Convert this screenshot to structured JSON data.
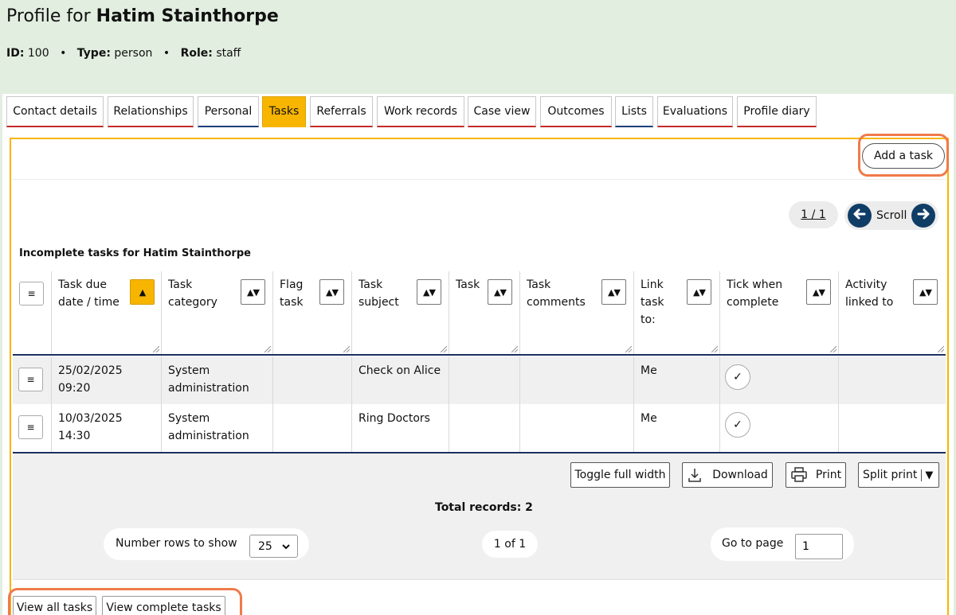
{
  "header": {
    "title_prefix": "Profile for",
    "person_name": "Hatim Stainthorpe",
    "id_label": "ID:",
    "id_value": "100",
    "type_label": "Type:",
    "type_value": "person",
    "role_label": "Role:",
    "role_value": "staff",
    "separator": "•"
  },
  "tabs": [
    {
      "label": "Contact details"
    },
    {
      "label": "Relationships"
    },
    {
      "label": "Personal"
    },
    {
      "label": "Tasks",
      "active": true
    },
    {
      "label": "Referrals"
    },
    {
      "label": "Work records"
    },
    {
      "label": "Case view"
    },
    {
      "label": "Outcomes"
    },
    {
      "label": "Lists"
    },
    {
      "label": "Evaluations"
    },
    {
      "label": "Profile diary"
    }
  ],
  "toolbar": {
    "add_task_label": "Add a task"
  },
  "pager": {
    "page_indicator": "1 / 1",
    "scroll_label": "Scroll"
  },
  "table": {
    "caption": "Incomplete tasks for Hatim Stainthorpe",
    "menu_glyph": "≡",
    "sort_glyph": "▲▼",
    "sort_active_glyph": "▲",
    "columns": [
      {
        "label": "Task due date / time"
      },
      {
        "label": "Task category"
      },
      {
        "label": "Flag task"
      },
      {
        "label": "Task subject"
      },
      {
        "label": "Task"
      },
      {
        "label": "Task comments"
      },
      {
        "label": "Link task to:"
      },
      {
        "label": "Tick when complete"
      },
      {
        "label": "Activity linked to"
      }
    ],
    "rows": [
      {
        "due": "25/02/2025 09:20",
        "category": "System administration",
        "flag": "",
        "subject": "Check on Alice",
        "task": "",
        "comments": "",
        "link": "Me",
        "tick": "✓",
        "activity": ""
      },
      {
        "due": "10/03/2025 14:30",
        "category": "System administration",
        "flag": "",
        "subject": "Ring Doctors",
        "task": "",
        "comments": "",
        "link": "Me",
        "tick": "✓",
        "activity": ""
      }
    ]
  },
  "footer": {
    "toggle_width_label": "Toggle full width",
    "download_label": "Download",
    "print_label": "Print",
    "split_print_label": "Split print",
    "split_print_caret": "▼",
    "total_records": "Total records: 2",
    "rows_to_show_label": "Number rows to show",
    "rows_to_show_value": "25",
    "page_of": "1 of 1",
    "go_to_page_label": "Go to page",
    "go_to_page_value": "1"
  },
  "bottom": {
    "view_all_label": "View all tasks",
    "view_complete_label": "View complete tasks"
  },
  "colors": {
    "header_bg": "#e2eee0",
    "accent": "#f7b500",
    "highlight": "#f07a4a",
    "nav_dark": "#103d66"
  }
}
